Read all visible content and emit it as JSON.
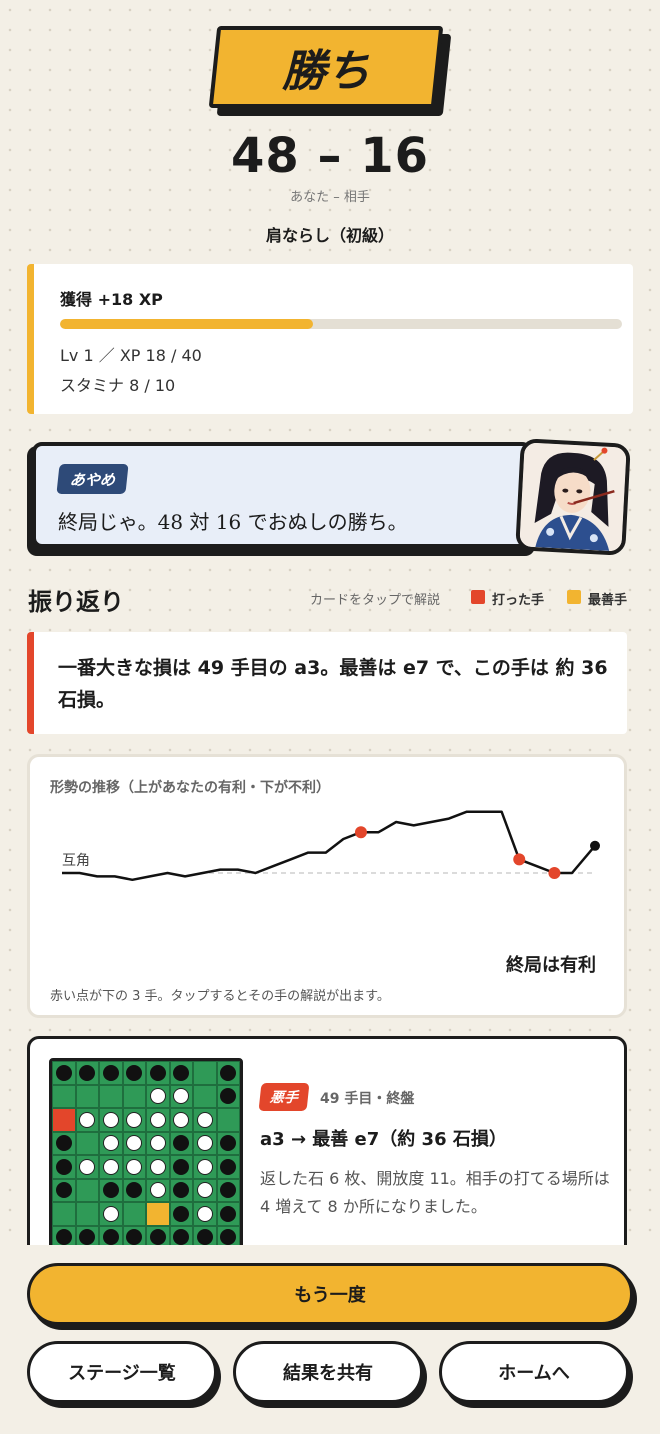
{
  "result": {
    "label": "勝ち",
    "score": "48 – 16",
    "score_caption": "あなた – 相手",
    "stage": "肩ならし（初級）"
  },
  "xp": {
    "gained": "獲得 +18 XP",
    "progress": 0.45,
    "level_line": "Lv 1 ／ XP 18 / 40",
    "stamina_line": "スタミナ 8 / 10"
  },
  "character": {
    "name": "あやめ",
    "message": "終局じゃ。48 対 16 でおぬしの勝ち。"
  },
  "review": {
    "title": "振り返り",
    "hint": "カードをタップで解説",
    "legend_played": "打った手",
    "legend_best": "最善手",
    "worst_summary": "一番大きな損は 49 手目の a3。最善は e7 で、この手は 約 36 石損。"
  },
  "chart": {
    "title": "形勢の推移（上があなたの有利・下が不利）",
    "baseline_label": "互角",
    "end_label": "終局は有利",
    "footnote": "赤い点が下の 3 手。タップするとその手の解説が出ます。"
  },
  "chart_data": {
    "type": "line",
    "title": "形勢の推移（上があなたの有利・下が不利）",
    "x": [
      1,
      2,
      3,
      4,
      5,
      6,
      7,
      8,
      9,
      10,
      11,
      12,
      13,
      14,
      15,
      16,
      17,
      18,
      19,
      20,
      21,
      22,
      23,
      24,
      25,
      26,
      27,
      28,
      29,
      30
    ],
    "series": [
      {
        "values": [
          0,
          0,
          -1,
          -1,
          -2,
          -1,
          0,
          -1,
          0,
          1,
          1,
          0,
          2,
          4,
          6,
          6,
          10,
          12,
          12,
          15,
          14,
          15,
          16,
          18,
          18,
          18,
          4,
          2,
          0,
          0
        ]
      }
    ],
    "highlight_points": [
      {
        "x": 18,
        "y": 12
      },
      {
        "x": 27,
        "y": 4
      },
      {
        "x": 29,
        "y": 0
      }
    ],
    "baseline": 0,
    "end_value": 8
  },
  "move": {
    "tag": "悪手",
    "meta": "49 手目・終盤",
    "headline": "a3 → 最善 e7（約 36 石損）",
    "description": "返した石 6 枚、開放度 11。相手の打てる場所は 4 増えて 8 か所になりました。",
    "board": [
      "bbbbbb.b",
      "....ww.b",
      "Rwwwwww.",
      "b.wwwbwb",
      "bwwwwbwb",
      "b.bbwbwb",
      "..w.Gbwb",
      "bbbbbbbb"
    ]
  },
  "buttons": {
    "retry": "もう一度",
    "stages": "ステージ一覧",
    "share": "結果を共有",
    "home": "ホームへ"
  },
  "colors": {
    "accent": "#f2b430",
    "bad": "#e3462b",
    "dark": "#1c1c1c",
    "board": "#2f9a57",
    "tag_blue": "#2e4a78"
  }
}
